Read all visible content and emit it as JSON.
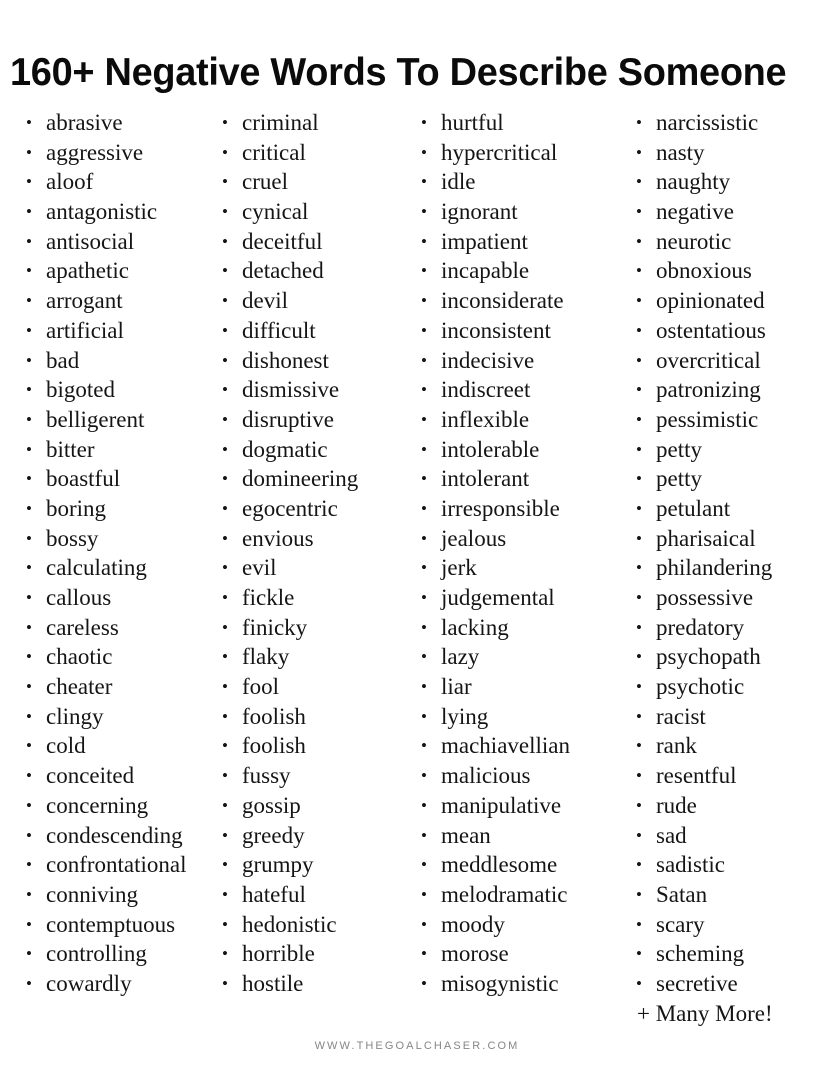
{
  "page": {
    "title": "160+ Negative Words To Describe Someone",
    "background_color": "#ffffff",
    "text_color": "#151515",
    "footer_color": "#868686"
  },
  "columns": [
    {
      "index": 1,
      "items": [
        "abrasive",
        "aggressive",
        "aloof",
        "antagonistic",
        "antisocial",
        "apathetic",
        "arrogant",
        "artificial",
        "bad",
        "bigoted",
        "belligerent",
        "bitter",
        "boastful",
        "boring",
        "bossy",
        "calculating",
        "callous",
        "careless",
        "chaotic",
        "cheater",
        "clingy",
        "cold",
        "conceited",
        "concerning",
        "condescending",
        "confrontational",
        "conniving",
        "contemptuous",
        "controlling",
        "cowardly"
      ]
    },
    {
      "index": 2,
      "items": [
        "criminal",
        "critical",
        "cruel",
        "cynical",
        "deceitful",
        "detached",
        "devil",
        "difficult",
        "dishonest",
        "dismissive",
        "disruptive",
        "dogmatic",
        "domineering",
        "egocentric",
        "envious",
        "evil",
        "fickle",
        "finicky",
        "flaky",
        "fool",
        "foolish",
        "foolish",
        "fussy",
        "gossip",
        "greedy",
        "grumpy",
        "hateful",
        "hedonistic",
        "horrible",
        "hostile"
      ]
    },
    {
      "index": 3,
      "items": [
        "hurtful",
        "hypercritical",
        "idle",
        "ignorant",
        "impatient",
        "incapable",
        "inconsiderate",
        "inconsistent",
        "indecisive",
        "indiscreet",
        "inflexible",
        "intolerable",
        "intolerant",
        "irresponsible",
        "jealous",
        "jerk",
        "judgemental",
        "lacking",
        "lazy",
        "liar",
        "lying",
        "machiavellian",
        "malicious",
        "manipulative",
        "mean",
        "meddlesome",
        "melodramatic",
        "moody",
        "morose",
        "misogynistic"
      ]
    },
    {
      "index": 4,
      "items": [
        "narcissistic",
        "nasty",
        "naughty",
        "negative",
        "neurotic",
        "obnoxious",
        "opinionated",
        "ostentatious",
        "overcritical",
        "patronizing",
        "pessimistic",
        "petty",
        "petty",
        "petulant",
        "pharisaical",
        "philandering",
        "possessive",
        "predatory",
        "psychopath",
        "psychotic",
        "racist",
        "rank",
        "resentful",
        "rude",
        "sad",
        "sadistic",
        "Satan",
        "scary",
        "scheming",
        "secretive"
      ],
      "trailing_note": "+ Many More!"
    }
  ],
  "footer": {
    "website": "WWW.THEGOALCHASER.COM"
  }
}
